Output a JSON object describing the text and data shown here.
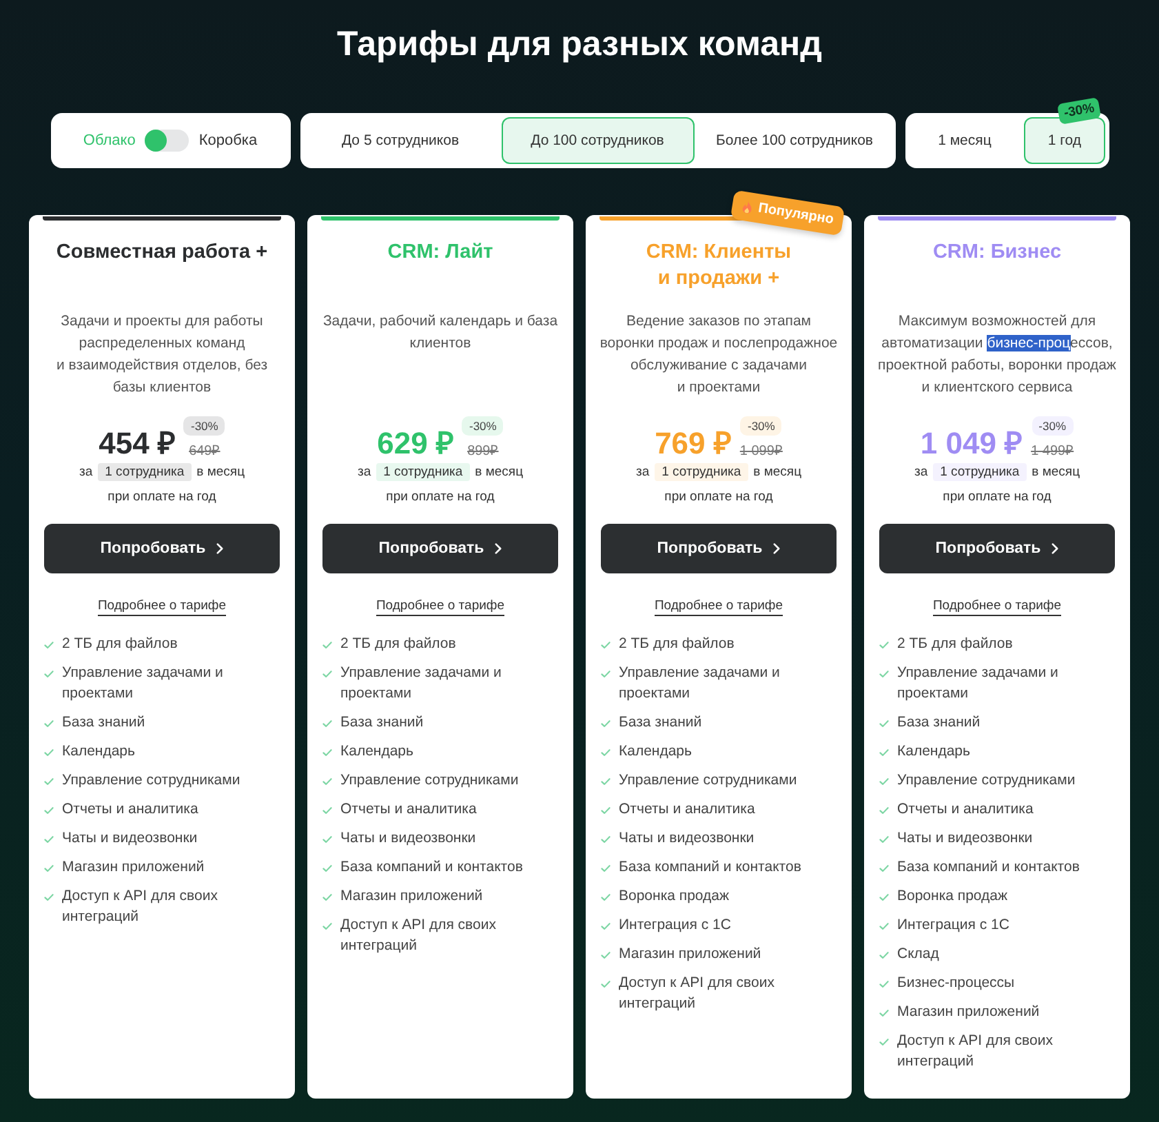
{
  "title": "Тарифы для разных команд",
  "deployment_toggle": {
    "options": [
      {
        "label": "Облако",
        "selected": true
      },
      {
        "label": "Коробка",
        "selected": false
      }
    ]
  },
  "team_size_tabs": [
    {
      "label": "До 5 сотрудников",
      "selected": false
    },
    {
      "label": "До 100 сотрудников",
      "selected": true
    },
    {
      "label": "Более 100 сотрудников",
      "selected": false
    }
  ],
  "billing_tabs": [
    {
      "label": "1 месяц",
      "selected": false
    },
    {
      "label": "1 год",
      "selected": true,
      "badge": "-30%"
    }
  ],
  "plans": [
    {
      "name": "Совместная работа +",
      "color": "#2b2d2f",
      "description": [
        {
          "text": "Задачи и проекты для работы\nраспределенных команд\nи взаимодействия отделов, без\nбазы клиентов",
          "highlighted": false
        }
      ],
      "price": "454 ₽",
      "discount": "-30%",
      "old_price": "649₽",
      "per_prefix": "за",
      "per_unit": "1 сотрудника",
      "per_suffix": "в месяц",
      "billing_note": "при оплате на год",
      "cta": "Попробовать",
      "details_link": "Подробнее о тарифе",
      "features": [
        "2 ТБ для файлов",
        "Управление задачами и проектами",
        "База знаний",
        "Календарь",
        "Управление сотрудниками",
        "Отчеты и аналитика",
        "Чаты и видеозвонки",
        "Магазин приложений",
        "Доступ к API для своих интеграций"
      ]
    },
    {
      "name": "CRM: Лайт",
      "color": "#2fc26b",
      "description": [
        {
          "text": "Задачи, рабочий календарь и база\nклиентов",
          "highlighted": false
        }
      ],
      "price": "629 ₽",
      "discount": "-30%",
      "old_price": "899₽",
      "per_prefix": "за",
      "per_unit": "1 сотрудника",
      "per_suffix": "в месяц",
      "billing_note": "при оплате на год",
      "cta": "Попробовать",
      "details_link": "Подробнее о тарифе",
      "features": [
        "2 ТБ для файлов",
        "Управление задачами и проектами",
        "База знаний",
        "Календарь",
        "Управление сотрудниками",
        "Отчеты и аналитика",
        "Чаты и видеозвонки",
        "База компаний и контактов",
        "Магазин приложений",
        "Доступ к API для своих интеграций"
      ]
    },
    {
      "name": "CRM: Клиенты\nи продажи +",
      "color": "#f7a12b",
      "badge": "Популярно",
      "description": [
        {
          "text": "Ведение заказов по этапам\nворонки продаж и послепродажное\nобслуживание с задачами\nи проектами",
          "highlighted": false
        }
      ],
      "price": "769 ₽",
      "discount": "-30%",
      "old_price": "1 099₽",
      "per_prefix": "за",
      "per_unit": "1 сотрудника",
      "per_suffix": "в месяц",
      "billing_note": "при оплате на год",
      "cta": "Попробовать",
      "details_link": "Подробнее о тарифе",
      "features": [
        "2 ТБ для файлов",
        "Управление задачами и проектами",
        "База знаний",
        "Календарь",
        "Управление сотрудниками",
        "Отчеты и аналитика",
        "Чаты и видеозвонки",
        "База компаний и контактов",
        "Воронка продаж",
        "Интеграция с 1С",
        "Магазин приложений",
        "Доступ к API для своих интеграций"
      ]
    },
    {
      "name": "CRM: Бизнес",
      "color": "#9f8cf3",
      "description": [
        {
          "text": "Максимум возможностей для\nавтоматизации ",
          "highlighted": false
        },
        {
          "text": "бизнес-проц",
          "highlighted": true
        },
        {
          "text": "ессов,\nпроектной работы, воронки продаж\nи клиентского сервиса",
          "highlighted": false
        }
      ],
      "price": "1 049 ₽",
      "discount": "-30%",
      "old_price": "1 499₽",
      "per_prefix": "за",
      "per_unit": "1 сотрудника",
      "per_suffix": "в месяц",
      "billing_note": "при оплате на год",
      "cta": "Попробовать",
      "details_link": "Подробнее о тарифе",
      "features": [
        "2 ТБ для файлов",
        "Управление задачами и проектами",
        "База знаний",
        "Календарь",
        "Управление сотрудниками",
        "Отчеты и аналитика",
        "Чаты и видеозвонки",
        "База компаний и контактов",
        "Воронка продаж",
        "Интеграция с 1С",
        "Склад",
        "Бизнес-процессы",
        "Магазин приложений",
        "Доступ к API для своих интеграций"
      ]
    }
  ]
}
